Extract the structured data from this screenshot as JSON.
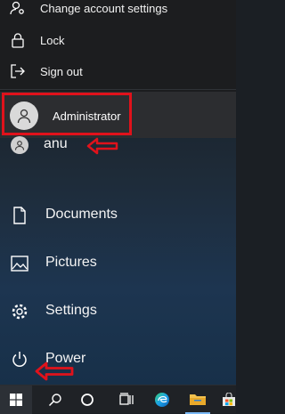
{
  "user_menu": {
    "change_settings_label": "Change account settings",
    "lock_label": "Lock",
    "sign_out_label": "Sign out"
  },
  "accounts": {
    "current_user": "Administrator",
    "other_user": "anu"
  },
  "nav": {
    "documents": "Documents",
    "pictures": "Pictures",
    "settings": "Settings",
    "power": "Power"
  },
  "annotation_color": "#e0121b",
  "taskbar": {
    "icons": [
      "windows-start-icon",
      "search-icon",
      "cortana-icon",
      "task-view-icon",
      "edge-icon",
      "file-explorer-icon",
      "store-icon"
    ]
  }
}
